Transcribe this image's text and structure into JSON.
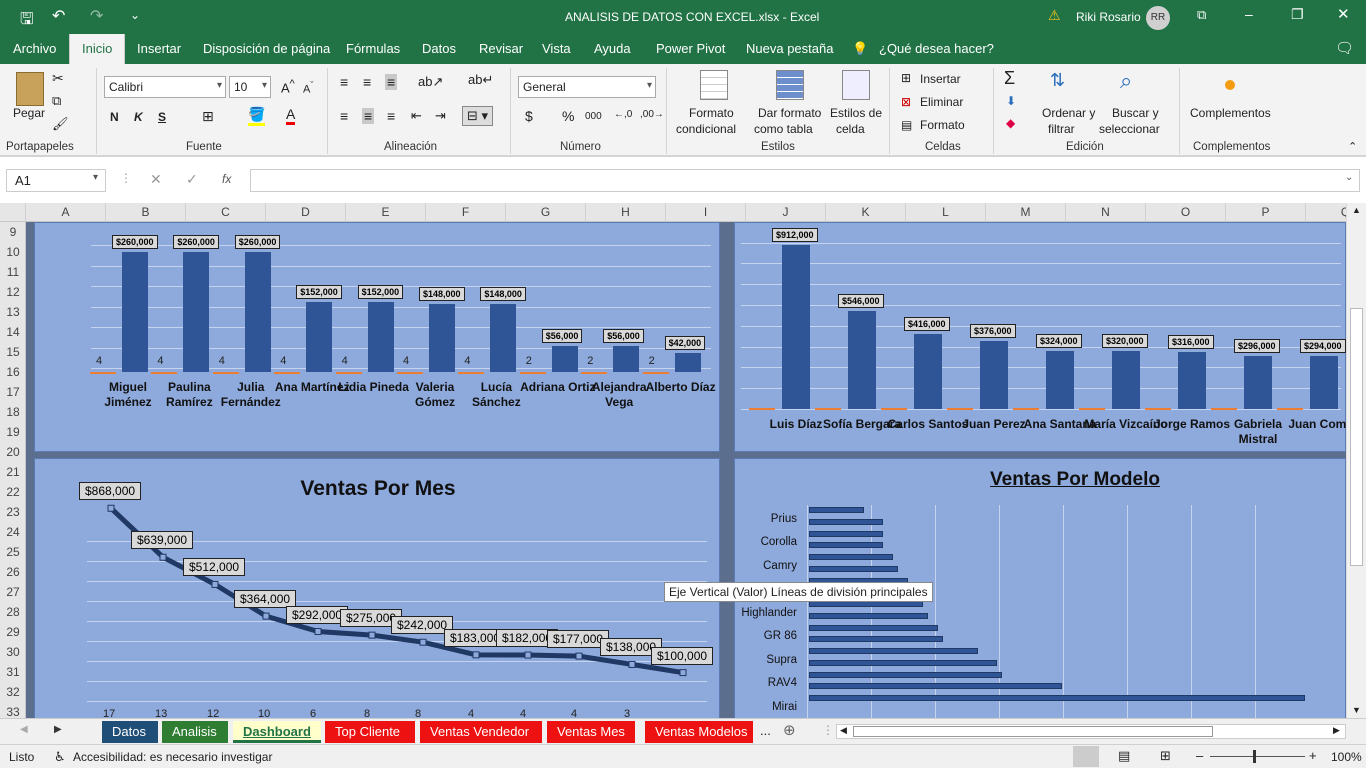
{
  "window": {
    "title": "ANALISIS DE DATOS CON EXCEL.xlsx - Excel",
    "user": "Riki Rosario",
    "initials": "RR",
    "warning": "⚠"
  },
  "menu": [
    "Archivo",
    "Inicio",
    "Insertar",
    "Disposición de página",
    "Fórmulas",
    "Datos",
    "Revisar",
    "Vista",
    "Ayuda",
    "Power Pivot",
    "Nueva pestaña",
    "¿Qué desea hacer?"
  ],
  "ribbon": {
    "portapapeles": {
      "paste": "Pegar",
      "label": "Portapapeles"
    },
    "fuente": {
      "font": "Calibri",
      "size": "10",
      "bold": "N",
      "italic": "K",
      "underline": "S",
      "label": "Fuente"
    },
    "alineacion": {
      "label": "Alineación"
    },
    "numero": {
      "format": "General",
      "currency": "$",
      "percent": "%",
      "thousands": "000",
      "label": "Número"
    },
    "estilos": {
      "cond1": "Formato",
      "cond2": "condicional",
      "table1": "Dar formato",
      "table2": "como tabla",
      "cell1": "Estilos de",
      "cell2": "celda",
      "label": "Estilos"
    },
    "celdas": {
      "insert": "Insertar",
      "delete": "Eliminar",
      "format": "Formato",
      "label": "Celdas"
    },
    "edicion": {
      "sort1": "Ordenar y",
      "sort2": "filtrar",
      "find1": "Buscar y",
      "find2": "seleccionar",
      "label": "Edición"
    },
    "complementos": {
      "btn": "Complementos",
      "label": "Complementos"
    }
  },
  "formula_bar": {
    "cell": "A1",
    "fx": "fx",
    "value": ""
  },
  "columns": [
    "A",
    "B",
    "C",
    "D",
    "E",
    "F",
    "G",
    "H",
    "I",
    "J",
    "K",
    "L",
    "M",
    "N",
    "O",
    "P",
    "Q"
  ],
  "rows": [
    "9",
    "10",
    "11",
    "12",
    "13",
    "14",
    "15",
    "16",
    "17",
    "18",
    "19",
    "20",
    "21",
    "22",
    "23",
    "24",
    "25",
    "26",
    "27",
    "28",
    "29",
    "30",
    "31",
    "32",
    "33"
  ],
  "chart_data": [
    {
      "type": "bar",
      "title": "",
      "categories": [
        "Miguel Jiménez",
        "Paulina Ramírez",
        "Julia Fernández",
        "Ana Martínez",
        "Lidia Pineda",
        "Valeria Gómez",
        "Lucía Sánchez",
        "Adriana Ortiz",
        "Alejandra Vega",
        "Alberto Díaz"
      ],
      "series": [
        {
          "values": [
            4,
            4,
            4,
            4,
            4,
            4,
            4,
            2,
            2,
            2
          ]
        },
        {
          "values": [
            260000,
            260000,
            260000,
            152000,
            152000,
            148000,
            148000,
            56000,
            56000,
            42000
          ]
        }
      ],
      "labels": [
        "$260,000",
        "$260,000",
        "$260,000",
        "$152,000",
        "$152,000",
        "$148,000",
        "$148,000",
        "$56,000",
        "$56,000",
        "$42,000"
      ],
      "count_labels": [
        "4",
        "4",
        "4",
        "4",
        "4",
        "4",
        "4",
        "2",
        "2",
        "2"
      ],
      "ylim": [
        0,
        300000
      ]
    },
    {
      "type": "bar",
      "title": "",
      "categories": [
        "Luis Díaz",
        "Sofía Bergara",
        "Carlos Santos",
        "Juan Perez",
        "Ana Santana",
        "María Vizcaíno",
        "Jorge Ramos",
        "Gabriela Mistral",
        "Juan Comila"
      ],
      "series": [
        {
          "values": [
            912000,
            546000,
            416000,
            376000,
            324000,
            320000,
            316000,
            296000,
            294000
          ]
        }
      ],
      "labels": [
        "$912,000",
        "$546,000",
        "$416,000",
        "$376,000",
        "$324,000",
        "$320,000",
        "$316,000",
        "$296,000",
        "$294,000"
      ],
      "ylim": [
        0,
        1000000
      ]
    },
    {
      "type": "line",
      "title": "Ventas Por Mes",
      "values": [
        868000,
        639000,
        512000,
        364000,
        292000,
        275000,
        242000,
        183000,
        182000,
        177000,
        138000,
        100000
      ],
      "labels": [
        "$868,000",
        "$639,000",
        "$512,000",
        "$364,000",
        "$292,000",
        "$275,000",
        "$242,000",
        "$183,000",
        "$182,000",
        "$177,000",
        "$138,000",
        "$100,000"
      ],
      "bottom_labels": [
        "17",
        "13",
        "12",
        "10",
        "6",
        "8",
        "8",
        "4",
        "4",
        "4",
        "3"
      ]
    },
    {
      "type": "bar",
      "orientation": "horizontal",
      "title": "Ventas Por Modelo",
      "categories": [
        "",
        "Prius",
        "",
        "Corolla",
        "",
        "Camry",
        "",
        "",
        "",
        "Highlander",
        "",
        "GR 86",
        "",
        "Supra",
        "",
        "RAV4",
        "",
        "Mirai"
      ],
      "values": [
        0.11,
        0.15,
        0.15,
        0.15,
        0.17,
        0.18,
        0.2,
        0.22,
        0.23,
        0.24,
        0.26,
        0.27,
        0.34,
        0.38,
        0.39,
        0.51,
        1.0,
        0.0
      ]
    }
  ],
  "tooltip": "Eje Vertical (Valor)  Líneas de división principales",
  "sheets": [
    {
      "name": "Datos",
      "color": "#1f4e79"
    },
    {
      "name": "Analisis",
      "color": "#2e7d32"
    },
    {
      "name": "Dashboard",
      "color": "#ffffcc"
    },
    {
      "name": "Top Cliente",
      "color": "#ee1111"
    },
    {
      "name": "Ventas Vendedor",
      "color": "#ee1111"
    },
    {
      "name": "Ventas Mes",
      "color": "#ee1111"
    },
    {
      "name": "Ventas Modelos",
      "color": "#ee1111"
    }
  ],
  "more_tabs": "...",
  "status": {
    "ready": "Listo",
    "accessibility": "Accesibilidad: es necesario investigar",
    "zoom": "100%"
  }
}
